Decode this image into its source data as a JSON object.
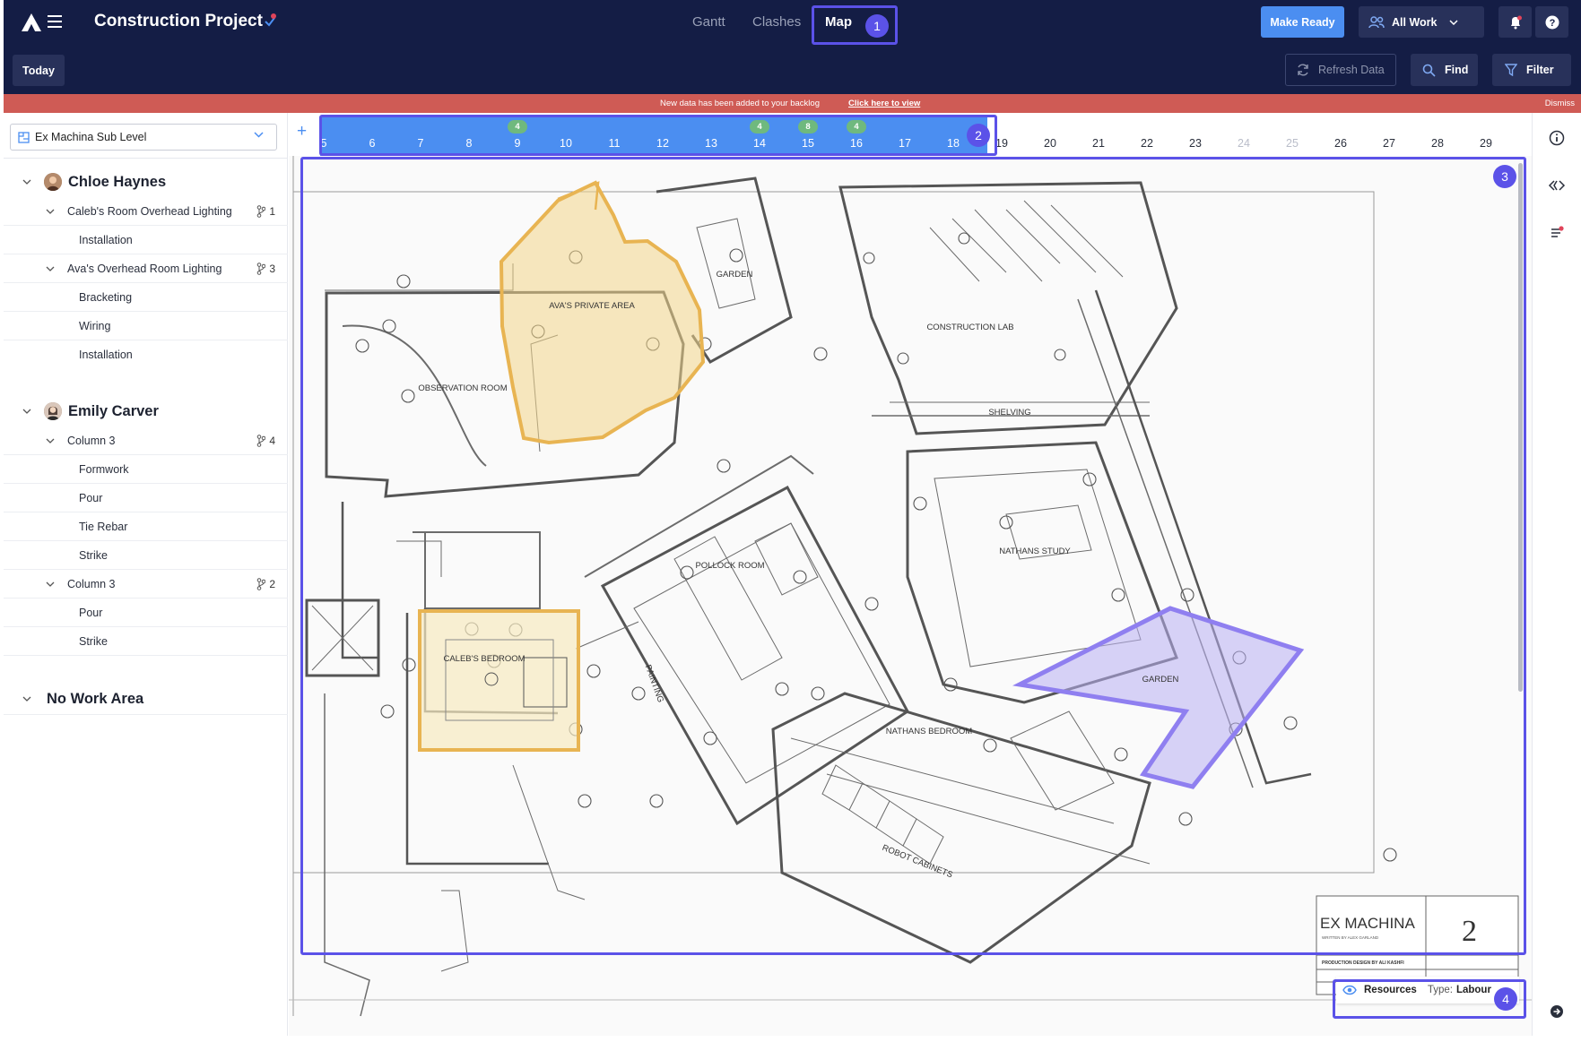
{
  "header": {
    "title": "Construction Project",
    "tabs": [
      {
        "label": "Gantt",
        "active": false
      },
      {
        "label": "Clashes",
        "active": false
      },
      {
        "label": "Map",
        "active": true
      }
    ],
    "make_ready_label": "Make Ready",
    "all_work_label": "All Work"
  },
  "toolbar": {
    "today_label": "Today",
    "refresh_label": "Refresh Data",
    "find_label": "Find",
    "filter_label": "Filter"
  },
  "banner": {
    "message": "New data has been added to your backlog",
    "link_text": "Click here to view",
    "dismiss_label": "Dismiss"
  },
  "sidebar": {
    "level_select_value": "Ex Machina Sub Level",
    "people": [
      {
        "name": "Chloe Haynes",
        "groups": [
          {
            "label": "Caleb's Room Overhead Lighting",
            "count": "1",
            "tasks": [
              "Installation"
            ]
          },
          {
            "label": "Ava's Overhead Room Lighting",
            "count": "3",
            "tasks": [
              "Bracketing",
              "Wiring",
              "Installation"
            ]
          }
        ]
      },
      {
        "name": "Emily Carver",
        "groups": [
          {
            "label": "Column 3",
            "count": "4",
            "tasks": [
              "Formwork",
              "Pour",
              "Tie Rebar",
              "Strike"
            ]
          },
          {
            "label": "Column 3",
            "count": "2",
            "tasks": [
              "Pour",
              "Strike"
            ]
          }
        ]
      }
    ],
    "no_work_area_label": "No Work Area"
  },
  "timeline": {
    "days": [
      "5",
      "6",
      "7",
      "8",
      "9",
      "10",
      "11",
      "12",
      "13",
      "14",
      "15",
      "16",
      "17",
      "18",
      "19",
      "20",
      "21",
      "22",
      "23",
      "24",
      "25",
      "26",
      "27",
      "28",
      "29"
    ],
    "badges": [
      {
        "day": "9",
        "count": "4"
      },
      {
        "day": "14",
        "count": "4"
      },
      {
        "day": "15",
        "count": "8"
      },
      {
        "day": "16",
        "count": "4"
      }
    ],
    "muted_days": [
      "24",
      "25"
    ]
  },
  "map": {
    "room_labels": {
      "avas_private_area": "AVA'S PRIVATE AREA",
      "observation_room": "OBSERVATION ROOM",
      "garden_top": "GARDEN",
      "construction_lab": "CONSTRUCTION LAB",
      "shelving": "SHELVING",
      "pollock_room": "POLLOCK ROOM",
      "nathans_study": "NATHANS STUDY",
      "calebs_bedroom": "CALEB'S BEDROOM",
      "garden_bottom": "GARDEN",
      "nathans_bedroom": "NATHANS BEDROOM",
      "robot_cabinets": "ROBOT CABINETS",
      "painting": "PAINTING"
    },
    "title_block": {
      "name": "EX MACHINA",
      "written_by": "WRITTEN BY ALEX GARLAND",
      "production": "PRODUCTION DESIGN BY ALI KASHFI",
      "sheet_number": "2"
    },
    "highlight_colors": {
      "work_area": "#e8b452",
      "work_area_fill": "#f2d58a",
      "selected_area": "#8f7ff0",
      "selected_area_fill": "#b8aef2"
    }
  },
  "resources_pill": {
    "label": "Resources",
    "type_label": "Type:",
    "type_value": "Labour"
  },
  "annotations": [
    "1",
    "2",
    "3",
    "4"
  ],
  "colors": {
    "nav_bg": "#141d45",
    "accent": "#4b8ef1",
    "banner": "#cf5b55",
    "badge": "#6fb97e",
    "annotation": "#5b52e8"
  }
}
